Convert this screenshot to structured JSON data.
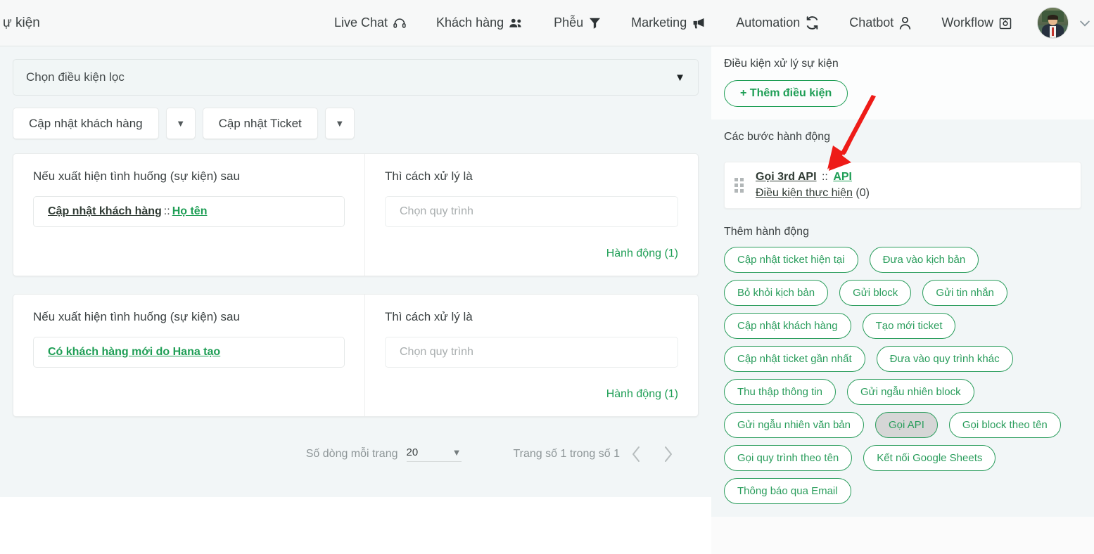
{
  "topnav": {
    "left_title": "ự kiện",
    "items": [
      {
        "label": "Live Chat",
        "icon": "headset-icon"
      },
      {
        "label": "Khách hàng",
        "icon": "people-icon"
      },
      {
        "label": "Phễu",
        "icon": "funnel-icon"
      },
      {
        "label": "Marketing",
        "icon": "megaphone-icon"
      },
      {
        "label": "Automation",
        "icon": "refresh-icon"
      },
      {
        "label": "Chatbot",
        "icon": "person-icon"
      },
      {
        "label": "Workflow",
        "icon": "workflow-icon"
      }
    ],
    "avatar": "user-avatar",
    "caret": "chevron-down-icon"
  },
  "left": {
    "filter_placeholder": "Chọn điều kiện lọc",
    "buttons": [
      {
        "label": "Cập nhật khách hàng"
      },
      {
        "label": "Cập nhật Ticket"
      }
    ],
    "cards": [
      {
        "condition_header": "Nếu xuất hiện tình huống (sự kiện) sau",
        "event_main": "Cập nhật khách hàng",
        "event_sep": "::",
        "event_field": "Họ tên",
        "action_header": "Thì cách xử lý là",
        "process_placeholder": "Chọn quy trình",
        "action_link": "Hành động (1)"
      },
      {
        "condition_header": "Nếu xuất hiện tình huống (sự kiện) sau",
        "event_main": "Có khách hàng mới do Hana tạo",
        "event_sep": "",
        "event_field": "",
        "action_header": "Thì cách xử lý là",
        "process_placeholder": "Chọn quy trình",
        "action_link": "Hành động (1)"
      }
    ],
    "pager": {
      "rows_label": "Số dòng mỗi trang",
      "rows_value": "20",
      "page_info": "Trang số 1 trong số 1",
      "prev_icon": "chevron-left-icon",
      "next_icon": "chevron-right-icon"
    }
  },
  "right": {
    "conditions_title": "Điều kiện xử lý sự kiện",
    "add_condition_label": "+ Thêm điều kiện",
    "steps_title": "Các bước hành động",
    "step": {
      "drag_handle": "drag-handle-icon",
      "name": "Gọi 3rd API",
      "sep": "::",
      "type": "API",
      "exec_cond_label": "Điều kiện thực hiện",
      "exec_cond_count": "(0)"
    },
    "add_action_title": "Thêm hành động",
    "action_chips": [
      {
        "label": "Cập nhật ticket hiện tại",
        "selected": false
      },
      {
        "label": "Đưa vào kịch bản",
        "selected": false
      },
      {
        "label": "Bỏ khỏi kịch bản",
        "selected": false
      },
      {
        "label": "Gửi block",
        "selected": false
      },
      {
        "label": "Gửi tin nhắn",
        "selected": false
      },
      {
        "label": "Cập nhật khách hàng",
        "selected": false
      },
      {
        "label": "Tạo mới ticket",
        "selected": false
      },
      {
        "label": "Cập nhật ticket gần nhất",
        "selected": false
      },
      {
        "label": "Đưa vào quy trình khác",
        "selected": false
      },
      {
        "label": "Thu thập thông tin",
        "selected": false
      },
      {
        "label": "Gửi ngẫu nhiên block",
        "selected": false
      },
      {
        "label": "Gửi ngẫu nhiên văn bản",
        "selected": false
      },
      {
        "label": "Gọi API",
        "selected": true
      },
      {
        "label": "Gọi block theo tên",
        "selected": false
      },
      {
        "label": "Gọi quy trình theo tên",
        "selected": false
      },
      {
        "label": "Kết nối Google Sheets",
        "selected": false
      },
      {
        "label": "Thông báo qua Email",
        "selected": false
      }
    ]
  },
  "annotation": {
    "arrow": "red-arrow-annotation",
    "color": "#ee1c18"
  },
  "colors": {
    "accent_green": "#1e9e55",
    "chip_green": "#2a9d5c",
    "panel_bg": "#f2f6f7",
    "selected_chip": "#d6d6d6"
  }
}
